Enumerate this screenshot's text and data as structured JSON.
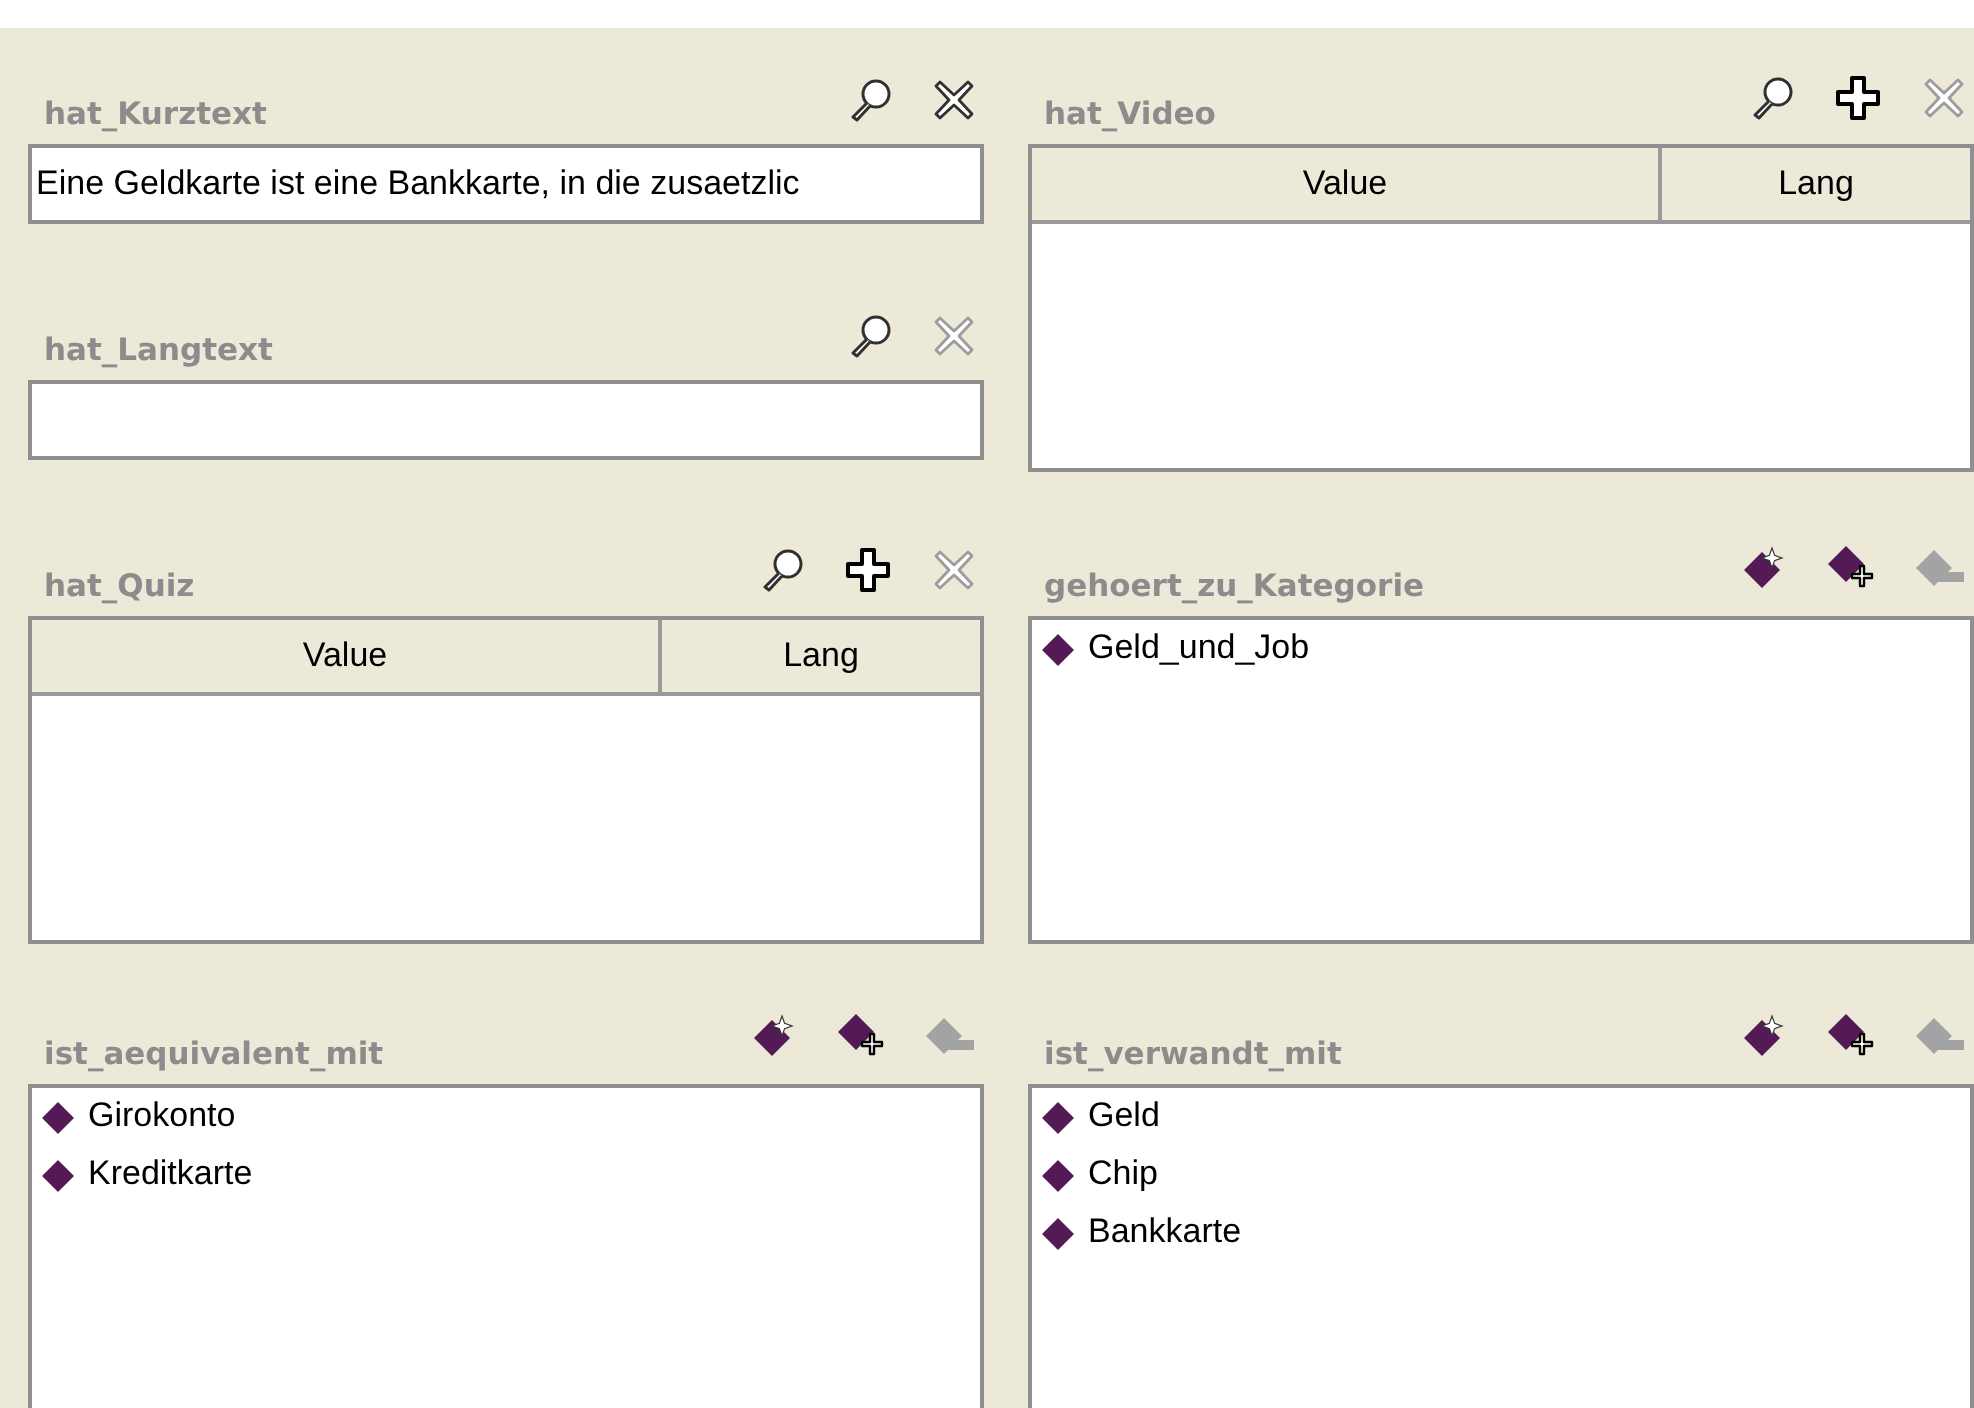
{
  "left_column": {
    "panels": [
      {
        "title": "hat_Kurztext",
        "kind": "field",
        "value": "Eine Geldkarte ist eine Bankkarte, in die zusaetzlic",
        "tools": [
          {
            "kind": "view",
            "disabled": false
          },
          {
            "kind": "delete",
            "disabled": false
          }
        ]
      },
      {
        "title": "hat_Langtext",
        "kind": "field",
        "tools": [
          {
            "kind": "view",
            "disabled": false
          },
          {
            "kind": "delete",
            "disabled": true
          }
        ]
      },
      {
        "title": "hat_Quiz",
        "kind": "table",
        "columns": [
          "Value",
          "Lang"
        ],
        "tools": [
          {
            "kind": "view",
            "disabled": false
          },
          {
            "kind": "add",
            "disabled": false
          },
          {
            "kind": "delete",
            "disabled": true
          }
        ]
      },
      {
        "title": "ist_aequivalent_mit",
        "kind": "list",
        "items": [
          "Girokonto",
          "Kreditkarte"
        ],
        "tools": [
          {
            "kind": "create",
            "disabled": false
          },
          {
            "kind": "add-instance",
            "disabled": false
          },
          {
            "kind": "remove",
            "disabled": true
          }
        ]
      }
    ]
  },
  "right_column": {
    "panels": [
      {
        "title": "hat_Video",
        "kind": "table",
        "columns": [
          "Value",
          "Lang"
        ],
        "tools": [
          {
            "kind": "view",
            "disabled": false
          },
          {
            "kind": "add",
            "disabled": false
          },
          {
            "kind": "delete",
            "disabled": true
          }
        ]
      },
      {
        "title": "gehoert_zu_Kategorie",
        "kind": "list",
        "items": [
          "Geld_und_Job"
        ],
        "tools": [
          {
            "kind": "create",
            "disabled": false
          },
          {
            "kind": "add-instance",
            "disabled": false
          },
          {
            "kind": "remove",
            "disabled": true
          }
        ]
      },
      {
        "title": "ist_verwandt_mit",
        "kind": "list",
        "items": [
          "Geld",
          "Chip",
          "Bankkarte"
        ],
        "tools": [
          {
            "kind": "create",
            "disabled": false
          },
          {
            "kind": "add-instance",
            "disabled": false
          },
          {
            "kind": "remove",
            "disabled": true
          }
        ]
      }
    ]
  }
}
